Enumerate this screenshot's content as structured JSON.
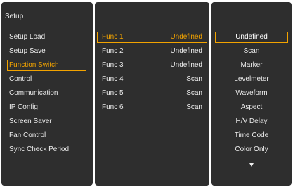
{
  "setup": {
    "title": "Setup",
    "items": [
      {
        "label": "Setup Load"
      },
      {
        "label": "Setup Save"
      },
      {
        "label": "Function Switch"
      },
      {
        "label": "Control"
      },
      {
        "label": "Communication"
      },
      {
        "label": "IP Config"
      },
      {
        "label": "Screen Saver"
      },
      {
        "label": "Fan Control"
      },
      {
        "label": "Sync Check Period"
      }
    ],
    "selected_index": 2
  },
  "functions": {
    "rows": [
      {
        "name": "Func 1",
        "value": "Undefined"
      },
      {
        "name": "Func 2",
        "value": "Undefined"
      },
      {
        "name": "Func 3",
        "value": "Undefined"
      },
      {
        "name": "Func 4",
        "value": "Scan"
      },
      {
        "name": "Func 5",
        "value": "Scan"
      },
      {
        "name": "Func 6",
        "value": "Scan"
      }
    ],
    "selected_index": 0
  },
  "options": {
    "items": [
      {
        "label": "Undefined"
      },
      {
        "label": "Scan"
      },
      {
        "label": "Marker"
      },
      {
        "label": "Levelmeter"
      },
      {
        "label": "Waveform"
      },
      {
        "label": "Aspect"
      },
      {
        "label": "H/V Delay"
      },
      {
        "label": "Time Code"
      },
      {
        "label": "Color Only"
      }
    ],
    "selected_index": 0,
    "more_indicator": "chevron-down-icon"
  },
  "colors": {
    "panel_background": "#2e2e2e",
    "text": "#ececec",
    "highlight": "#f2a300"
  }
}
